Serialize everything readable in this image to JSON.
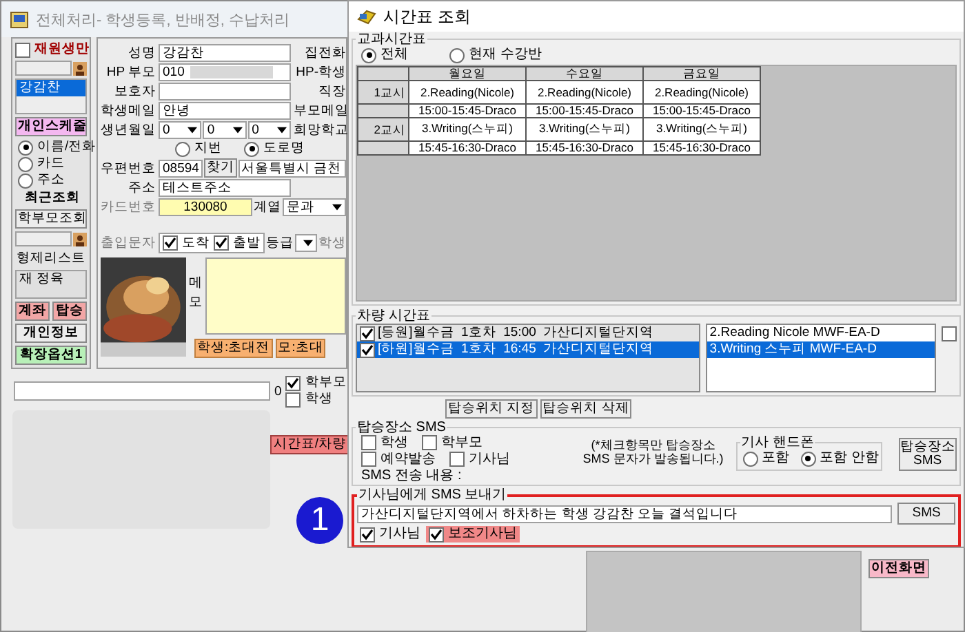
{
  "main_window": {
    "title": "전체처리- 학생등록, 반배정, 수납처리",
    "sidebar": {
      "enrolled_only": {
        "label": "재원생만",
        "checked": false
      },
      "student_list": [
        {
          "name": "강감찬",
          "selected": true
        }
      ],
      "schedule_button": "개인스케줄",
      "search_modes": [
        {
          "label": "이름/전화",
          "selected": true
        },
        {
          "label": "카드",
          "selected": false
        },
        {
          "label": "주소",
          "selected": false
        }
      ],
      "recent_label": "최근조회",
      "parent_search_button": "학부모조회",
      "siblings_label": "형제리스트",
      "sibling_list": [
        "재 정육"
      ],
      "pair_buttons": [
        "계좌",
        "탑승"
      ],
      "buttons": [
        {
          "label": "개인정보",
          "color": "#ececec"
        },
        {
          "label": "확장옵션1",
          "color": "#b8f0b8"
        }
      ]
    },
    "form": {
      "fields": [
        {
          "kind": "text",
          "label": "성명",
          "value": "강감찬",
          "side_label": "집전화"
        },
        {
          "kind": "text",
          "label": "HP 부모",
          "value": "010",
          "redacted": true,
          "side_label": "HP-학생"
        },
        {
          "kind": "text",
          "label": "보호자",
          "side_label": "직장"
        },
        {
          "kind": "text",
          "label": "학생메일",
          "value": "안녕",
          "side_label": "부모메일"
        },
        {
          "kind": "date",
          "label": "생년월일",
          "parts": [
            "0",
            "0",
            "0"
          ],
          "side_label": "희망학교"
        },
        {
          "kind": "radios",
          "options": [
            {
              "label": "지번",
              "selected": false
            },
            {
              "label": "도로명",
              "selected": true
            }
          ]
        },
        {
          "kind": "zip",
          "label": "우편번호",
          "value": "08594",
          "button": "찾기",
          "address": "서울특별시 금천"
        },
        {
          "kind": "text",
          "label": "주소",
          "value": "테스트주소"
        },
        {
          "kind": "card",
          "label": "카드번호",
          "value": "130080",
          "track_label": "계열",
          "track": "문과"
        },
        {
          "kind": "access",
          "label": "출입문자",
          "checks": [
            {
              "label": "도착",
              "checked": true
            },
            {
              "label": "출발",
              "checked": true
            }
          ],
          "grade_label": "등급",
          "side_label": "학생"
        }
      ],
      "memo_label": "메모",
      "invite_buttons": [
        "학생:초대전",
        "모:초대"
      ]
    },
    "bottom": {
      "count": "0",
      "targets": [
        {
          "label": "학부모",
          "checked": true
        },
        {
          "label": "학생",
          "checked": false
        }
      ],
      "timetable_button": "시간표/차량",
      "back_button": "이전화면"
    }
  },
  "timetable_dialog": {
    "title": "시간표 조회",
    "timetable": {
      "label": "교과시간표",
      "filters": [
        {
          "label": "전체",
          "selected": true
        },
        {
          "label": "현재 수강반",
          "selected": false
        }
      ],
      "columns": [
        "월요일",
        "수요일",
        "금요일"
      ],
      "rows": [
        {
          "period": "1교시",
          "cells": [
            {
              "class": "2.Reading(Nicole)",
              "time": "15:00-15:45-Draco"
            },
            {
              "class": "2.Reading(Nicole)",
              "time": "15:00-15:45-Draco"
            },
            {
              "class": "2.Reading(Nicole)",
              "time": "15:00-15:45-Draco"
            }
          ]
        },
        {
          "period": "2교시",
          "cells": [
            {
              "class": "3.Writing(스누피)",
              "time": "15:45-16:30-Draco"
            },
            {
              "class": "3.Writing(스누피)",
              "time": "15:45-16:30-Draco"
            },
            {
              "class": "3.Writing(스누피)",
              "time": "15:45-16:30-Draco"
            }
          ]
        }
      ]
    },
    "vehicle": {
      "label": "차량 시간표",
      "routes": [
        {
          "text": "[등원]월수금  1호차  15:00  가산디지털단지역",
          "checked": true,
          "selected": false
        },
        {
          "text": "[하원]월수금  1호차  16:45  가산디지털단지역",
          "checked": true,
          "selected": true
        }
      ],
      "classes": [
        {
          "text": "2.Reading Nicole MWF-EA-D",
          "selected": false
        },
        {
          "text": "3.Writing 스누피 MWF-EA-D",
          "selected": true
        }
      ],
      "side_check": {
        "checked": false
      },
      "buttons": [
        "탑승위치 지정",
        "탑승위치 삭제"
      ]
    },
    "pickup_sms": {
      "label": "탑승장소 SMS",
      "targets": [
        {
          "label": "학생",
          "checked": false
        },
        {
          "label": "학부모",
          "checked": false
        },
        {
          "label": "예약발송",
          "checked": false
        },
        {
          "label": "기사님",
          "checked": false
        }
      ],
      "note": "(*체크항목만 탑승장소\nSMS 문자가 발송됩니다.)",
      "driver_phone": {
        "label": "기사 핸드폰",
        "options": [
          {
            "label": "포함",
            "selected": false
          },
          {
            "label": "포함 안함",
            "selected": true
          }
        ]
      },
      "send_button": "탑승장소\nSMS",
      "content_label": "SMS 전송 내용 :"
    },
    "driver_sms": {
      "label": "기사님에게 SMS 보내기",
      "emphasized": true,
      "message": "가산디지털단지역에서 하차하는 학생 강감찬 오늘 결석입니다",
      "button": "SMS",
      "recipients": [
        {
          "label": "기사님",
          "checked": true,
          "highlighted": false
        },
        {
          "label": "보조기사님",
          "checked": true,
          "highlighted": true
        }
      ]
    }
  },
  "annotation": {
    "marker": "1"
  }
}
